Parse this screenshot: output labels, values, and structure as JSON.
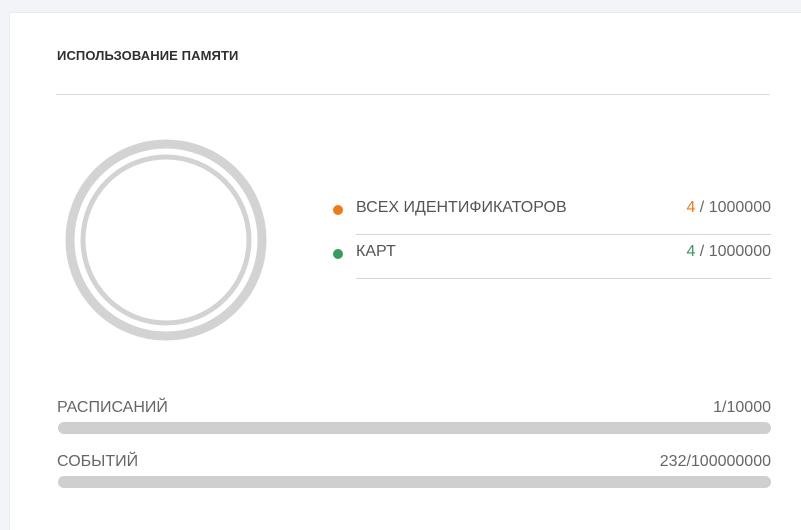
{
  "panel": {
    "title": "ИСПОЛЬЗОВАНИЕ ПАМЯТИ"
  },
  "memory_legend": [
    {
      "label": "ВСЕХ ИДЕНТИФИКАТОРОВ",
      "used": "4",
      "separator": " / ",
      "total": "1000000",
      "used_value": 4,
      "total_value": 1000000,
      "color": "#f07a1a"
    },
    {
      "label": "КАРТ",
      "used": "4",
      "separator": " / ",
      "total": "1000000",
      "used_value": 4,
      "total_value": 1000000,
      "color": "#3a9a5b"
    }
  ],
  "donut": {
    "ring_color": "#d3d3d3"
  },
  "progress": {
    "schedules": {
      "label": "РАСПИСАНИЙ",
      "value": "1/10000",
      "fraction": 0.0001
    },
    "events": {
      "label": "СОБЫТИЙ",
      "value": "232/100000000",
      "fraction": 2.32e-06
    }
  },
  "colors": {
    "card_bg": "#ffffff",
    "page_bg": "#f2f4f7",
    "track": "#cfcfcf"
  }
}
